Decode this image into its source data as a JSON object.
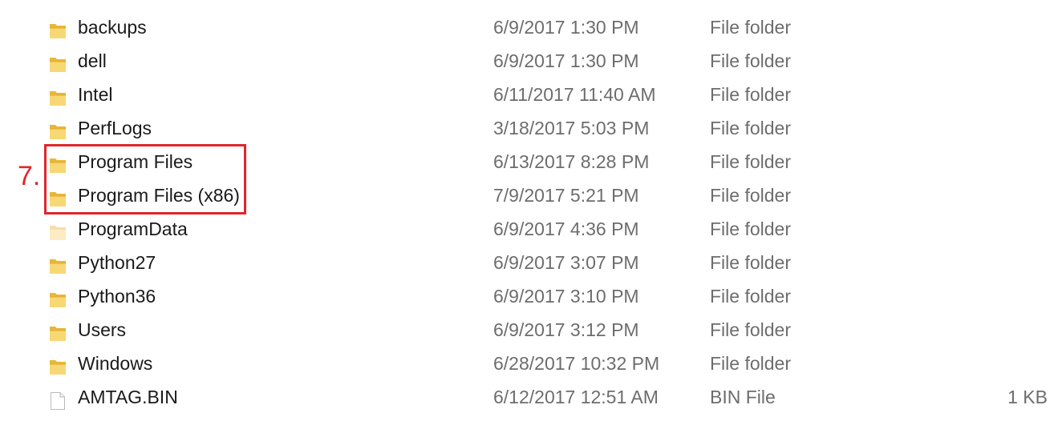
{
  "annotation": {
    "step_label": "7.",
    "highlight_color": "#e0262e"
  },
  "files": [
    {
      "name": "backups",
      "date": "6/9/2017 1:30 PM",
      "type": "File folder",
      "size": "",
      "icon": "folder-icon"
    },
    {
      "name": "dell",
      "date": "6/9/2017 1:30 PM",
      "type": "File folder",
      "size": "",
      "icon": "folder-icon"
    },
    {
      "name": "Intel",
      "date": "6/11/2017 11:40 AM",
      "type": "File folder",
      "size": "",
      "icon": "folder-icon"
    },
    {
      "name": "PerfLogs",
      "date": "3/18/2017 5:03 PM",
      "type": "File folder",
      "size": "",
      "icon": "folder-icon"
    },
    {
      "name": "Program Files",
      "date": "6/13/2017 8:28 PM",
      "type": "File folder",
      "size": "",
      "icon": "folder-icon"
    },
    {
      "name": "Program Files (x86)",
      "date": "7/9/2017 5:21 PM",
      "type": "File folder",
      "size": "",
      "icon": "folder-icon"
    },
    {
      "name": "ProgramData",
      "date": "6/9/2017 4:36 PM",
      "type": "File folder",
      "size": "",
      "icon": "hidden-folder-icon"
    },
    {
      "name": "Python27",
      "date": "6/9/2017 3:07 PM",
      "type": "File folder",
      "size": "",
      "icon": "folder-icon"
    },
    {
      "name": "Python36",
      "date": "6/9/2017 3:10 PM",
      "type": "File folder",
      "size": "",
      "icon": "folder-icon"
    },
    {
      "name": "Users",
      "date": "6/9/2017 3:12 PM",
      "type": "File folder",
      "size": "",
      "icon": "folder-icon"
    },
    {
      "name": "Windows",
      "date": "6/28/2017 10:32 PM",
      "type": "File folder",
      "size": "",
      "icon": "folder-icon"
    },
    {
      "name": "AMTAG.BIN",
      "date": "6/12/2017 12:51 AM",
      "type": "BIN File",
      "size": "1 KB",
      "icon": "file-icon"
    }
  ]
}
